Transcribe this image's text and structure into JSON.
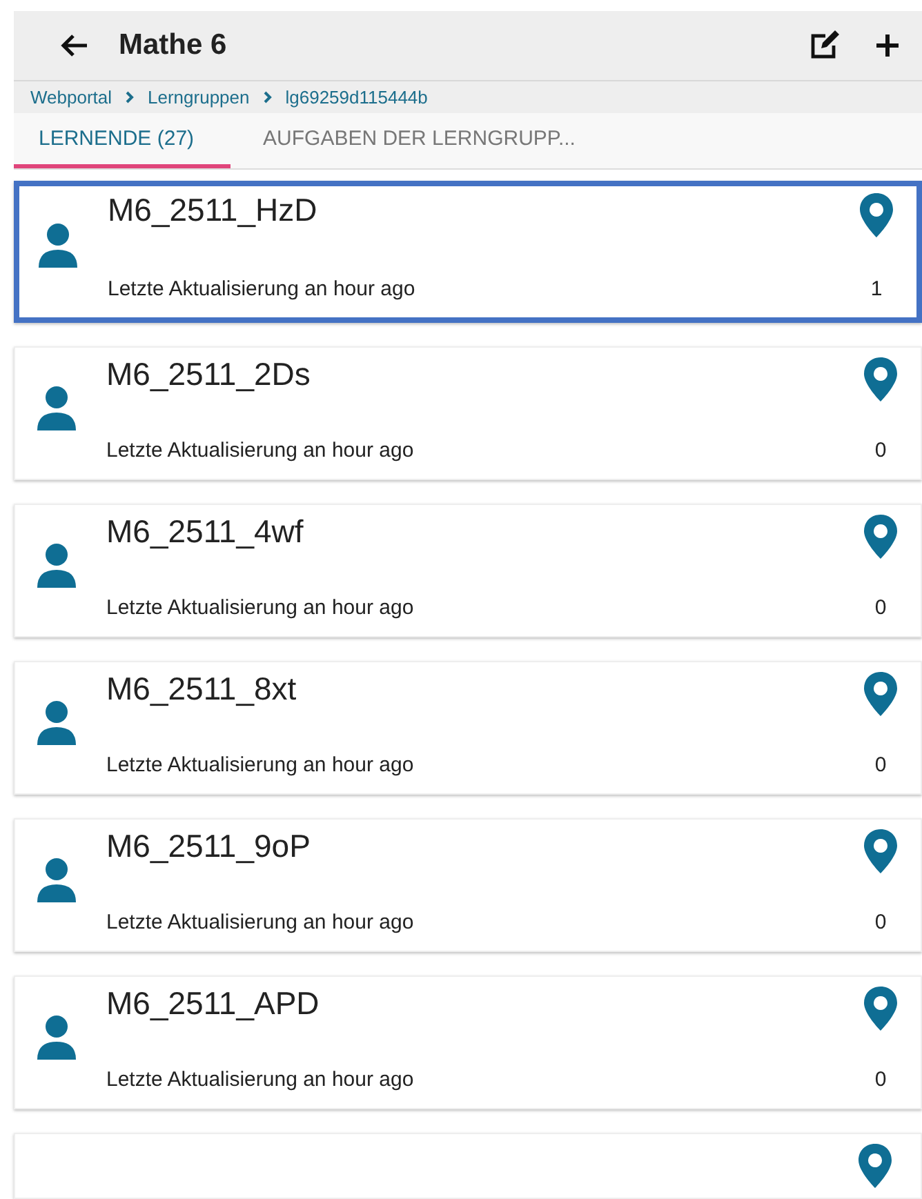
{
  "header": {
    "title": "Mathe 6"
  },
  "breadcrumb": [
    "Webportal",
    "Lerngruppen",
    "lg69259d115444b"
  ],
  "tabs": [
    {
      "label": "LERNENDE (27)",
      "selected": true
    },
    {
      "label": "AUFGABEN DER LERNGRUPP...",
      "selected": false
    }
  ],
  "students": [
    {
      "name": "M6_2511_HzD",
      "updated": "Letzte Aktualisierung an hour ago",
      "count": "1",
      "selected": true
    },
    {
      "name": "M6_2511_2Ds",
      "updated": "Letzte Aktualisierung an hour ago",
      "count": "0",
      "selected": false
    },
    {
      "name": "M6_2511_4wf",
      "updated": "Letzte Aktualisierung an hour ago",
      "count": "0",
      "selected": false
    },
    {
      "name": "M6_2511_8xt",
      "updated": "Letzte Aktualisierung an hour ago",
      "count": "0",
      "selected": false
    },
    {
      "name": "M6_2511_9oP",
      "updated": "Letzte Aktualisierung an hour ago",
      "count": "0",
      "selected": false
    },
    {
      "name": "M6_2511_APD",
      "updated": "Letzte Aktualisierung an hour ago",
      "count": "0",
      "selected": false
    }
  ]
}
